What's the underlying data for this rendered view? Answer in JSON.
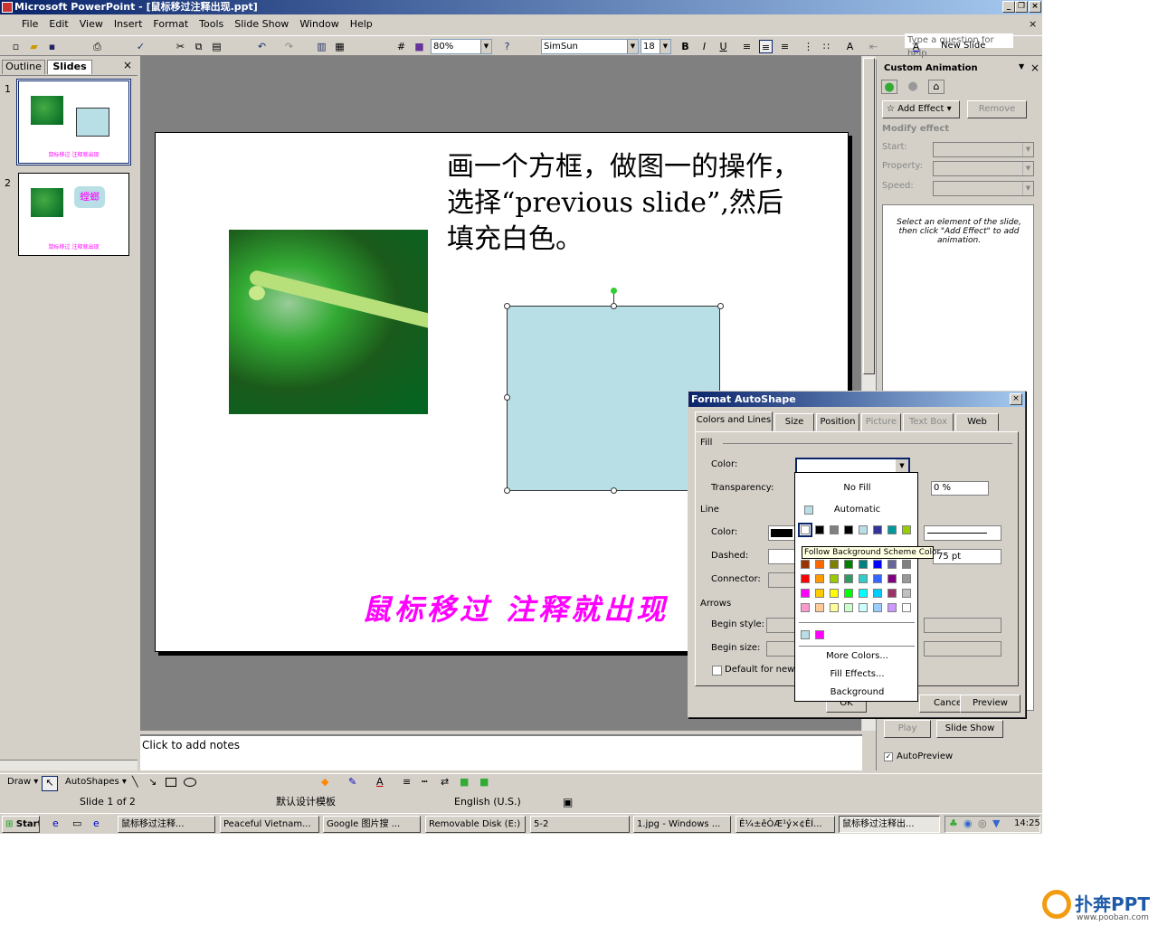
{
  "window": {
    "title": "Microsoft PowerPoint - [鼠标移过注释出现.ppt]"
  },
  "menu": [
    "File",
    "Edit",
    "View",
    "Insert",
    "Format",
    "Tools",
    "Slide Show",
    "Window",
    "Help"
  ],
  "ask": {
    "placeholder": "Type a question for help"
  },
  "toolbar": {
    "zoom": "80%",
    "font": "SimSun",
    "size": "18",
    "new_slide": "New Slide"
  },
  "leftpane": {
    "tab_outline": "Outline",
    "tab_slides": "Slides",
    "thumb1_caption": "鼠标移过 注释就出现",
    "thumb2_caption": "鼠标移过 注释就出现",
    "thumb2_bubble": "螳螂",
    "nums": [
      "1",
      "2"
    ]
  },
  "slide": {
    "text": "画一个方框，做图一的操作，选择“previous slide”,然后填充白色。",
    "caption": "鼠标移过 注释就出现"
  },
  "notes": {
    "placeholder": "Click to add notes"
  },
  "taskpane": {
    "title": "Custom Animation",
    "add_effect": "Add Effect",
    "remove": "Remove",
    "modify": "Modify effect",
    "start": "Start:",
    "property": "Property:",
    "speed": "Speed:",
    "hint": "Select an element of the slide, then click \"Add Effect\" to add animation.",
    "play": "Play",
    "slideshow": "Slide Show",
    "autopreview": "AutoPreview"
  },
  "dialog": {
    "title": "Format AutoShape",
    "tabs": [
      "Colors and Lines",
      "Size",
      "Position",
      "Picture",
      "Text Box",
      "Web"
    ],
    "fill": "Fill",
    "color": "Color:",
    "transparency": "Transparency:",
    "transparency_value": "0 %",
    "line": "Line",
    "line_color": "Color:",
    "dashed": "Dashed:",
    "weight_value": "75 pt",
    "connector": "Connector:",
    "arrows": "Arrows",
    "begin_style": "Begin style:",
    "begin_size": "Begin size:",
    "default": "Default for new o",
    "ok": "OK",
    "cancel": "Cancel",
    "preview": "Preview"
  },
  "palette": {
    "nofill": "No Fill",
    "automatic": "Automatic",
    "more": "More Colors...",
    "effects": "Fill Effects...",
    "background": "Background",
    "tooltip": "Follow Background Scheme Color",
    "scheme": [
      "#ffffff",
      "#000000",
      "#808080",
      "#000000",
      "#b8dfe6",
      "#333399",
      "#009999",
      "#99cc00"
    ],
    "std": [
      [
        "#993300",
        "#ff6600",
        "#808000",
        "#008000",
        "#008080",
        "#0000ff",
        "#666699",
        "#808080"
      ],
      [
        "#ff0000",
        "#ff9900",
        "#99cc00",
        "#339966",
        "#33cccc",
        "#3366ff",
        "#800080",
        "#999999"
      ],
      [
        "#ff00ff",
        "#ffcc00",
        "#ffff00",
        "#00ff00",
        "#00ffff",
        "#00ccff",
        "#993366",
        "#c0c0c0"
      ],
      [
        "#ff99cc",
        "#ffcc99",
        "#ffff99",
        "#ccffcc",
        "#ccffff",
        "#99ccff",
        "#cc99ff",
        "#ffffff"
      ]
    ],
    "recent": [
      "#b8dfe6",
      "#ff00ff"
    ]
  },
  "status": {
    "slide": "Slide 1 of 2",
    "design": "默认设计模板",
    "lang": "English (U.S.)"
  },
  "drawbar": {
    "draw": "Draw",
    "autoshapes": "AutoShapes"
  },
  "taskbar": {
    "start": "Start",
    "items": [
      "鼠标移过注释...",
      "Peaceful Vietnam...",
      "Google 图片搜 ...",
      "Removable Disk (E:)",
      "5-2",
      "1.jpg - Windows ...",
      "Ê¼±êÒÆ¹ý×¢ÊÍ...",
      "鼠标移过注释出..."
    ],
    "clock": "14:25"
  },
  "watermark": {
    "brand": "扑奔PPT",
    "url": "www.pooban.com"
  },
  "colors": {
    "accent": "#0a246a",
    "shape_fill": "#b8dfe6",
    "magenta": "#ff00ff"
  }
}
